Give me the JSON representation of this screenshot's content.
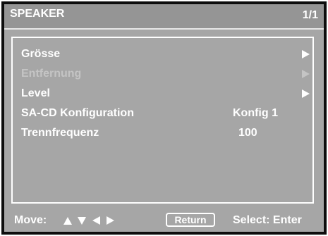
{
  "header": {
    "title": "SPEAKER",
    "page": "1/1"
  },
  "menu": {
    "items": [
      {
        "label": "Grösse",
        "value": "",
        "has_arrow": true,
        "enabled": true
      },
      {
        "label": "Entfernung",
        "value": "",
        "has_arrow": true,
        "enabled": false
      },
      {
        "label": "Level",
        "value": "",
        "has_arrow": true,
        "enabled": true
      },
      {
        "label": "SA-CD Konfiguration",
        "value": "Konfig 1",
        "has_arrow": false,
        "enabled": true
      },
      {
        "label": "Trennfrequenz",
        "value": "100",
        "has_arrow": false,
        "enabled": true
      }
    ]
  },
  "footer": {
    "move_label": "Move:",
    "return_label": "Return",
    "select_label": "Select: Enter"
  },
  "colors": {
    "background": "#a6a6a6",
    "header": "#959595",
    "text": "#ffffff",
    "disabled_text": "#c4c4c4",
    "frame": "#0d0d0d"
  }
}
